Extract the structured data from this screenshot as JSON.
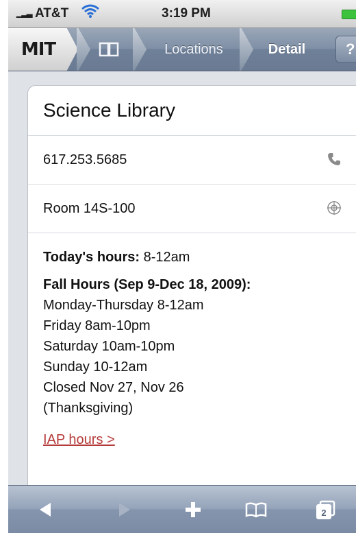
{
  "status_bar": {
    "carrier": "AT&T",
    "time": "3:19 PM"
  },
  "nav": {
    "home_logo": "MIT",
    "locations_label": "Locations",
    "detail_label": "Detail",
    "help_label": "?"
  },
  "detail": {
    "name": "Science Library",
    "phone": "617.253.5685",
    "room": "Room 14S-100",
    "todays_hours_label": "Today's hours:",
    "todays_hours_value": "8-12am",
    "fall_hours_heading": "Fall Hours (Sep 9-Dec 18, 2009):",
    "schedule": [
      "Monday-Thursday 8-12am",
      "Friday 8am-10pm",
      "Saturday 10am-10pm",
      "Sunday 10-12am",
      "Closed Nov 27, Nov 26",
      "(Thanksgiving)"
    ],
    "iap_link": "IAP hours >"
  },
  "toolbar": {
    "pages_count": "2"
  },
  "colors": {
    "link": "#b53a3a",
    "battery": "#3cc23c",
    "nav_blue": "#7f8fa5"
  }
}
